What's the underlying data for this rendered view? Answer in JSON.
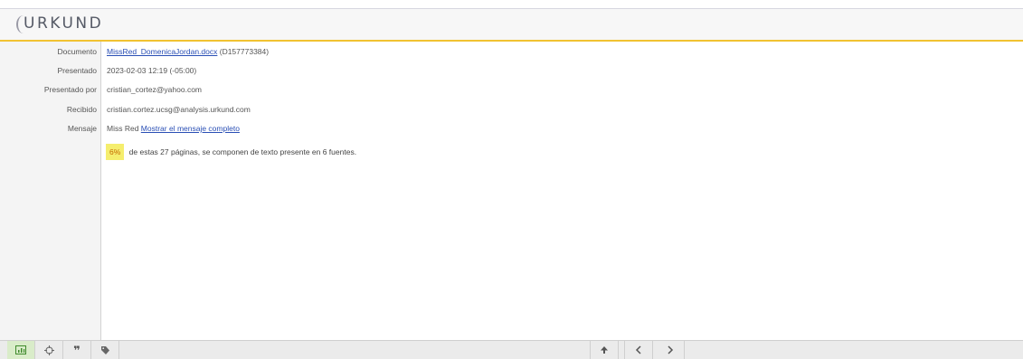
{
  "app": {
    "logo_text": "URKUND"
  },
  "details": {
    "documento": {
      "label": "Documento",
      "link_text": "MissRed_DomenicaJordan.docx",
      "suffix": " (D157773384)"
    },
    "presentado": {
      "label": "Presentado",
      "value": "2023-02-03 12:19 (-05:00)"
    },
    "presentado_por": {
      "label": "Presentado por",
      "value": "cristian_cortez@yahoo.com"
    },
    "recibido": {
      "label": "Recibido",
      "value": "cristian.cortez.ucsg@analysis.urkund.com"
    },
    "mensaje": {
      "label": "Mensaje",
      "value": "Miss Red ",
      "link_text": "Mostrar el mensaje completo"
    }
  },
  "summary": {
    "percent": "6%",
    "text": " de estas 27 páginas, se componen de texto presente en 6 fuentes."
  },
  "toolbar": {
    "left_icons": [
      "chart-icon",
      "target-icon",
      "quote-icon",
      "tag-icon"
    ],
    "nav_icons": [
      "arrow-up-icon",
      "chevron-left-icon",
      "chevron-right-icon"
    ]
  },
  "colors": {
    "accent": "#f1c232",
    "link": "#2a4fb5",
    "highlight": "#f5ee6e",
    "active_tab": "#d9ecc9"
  }
}
